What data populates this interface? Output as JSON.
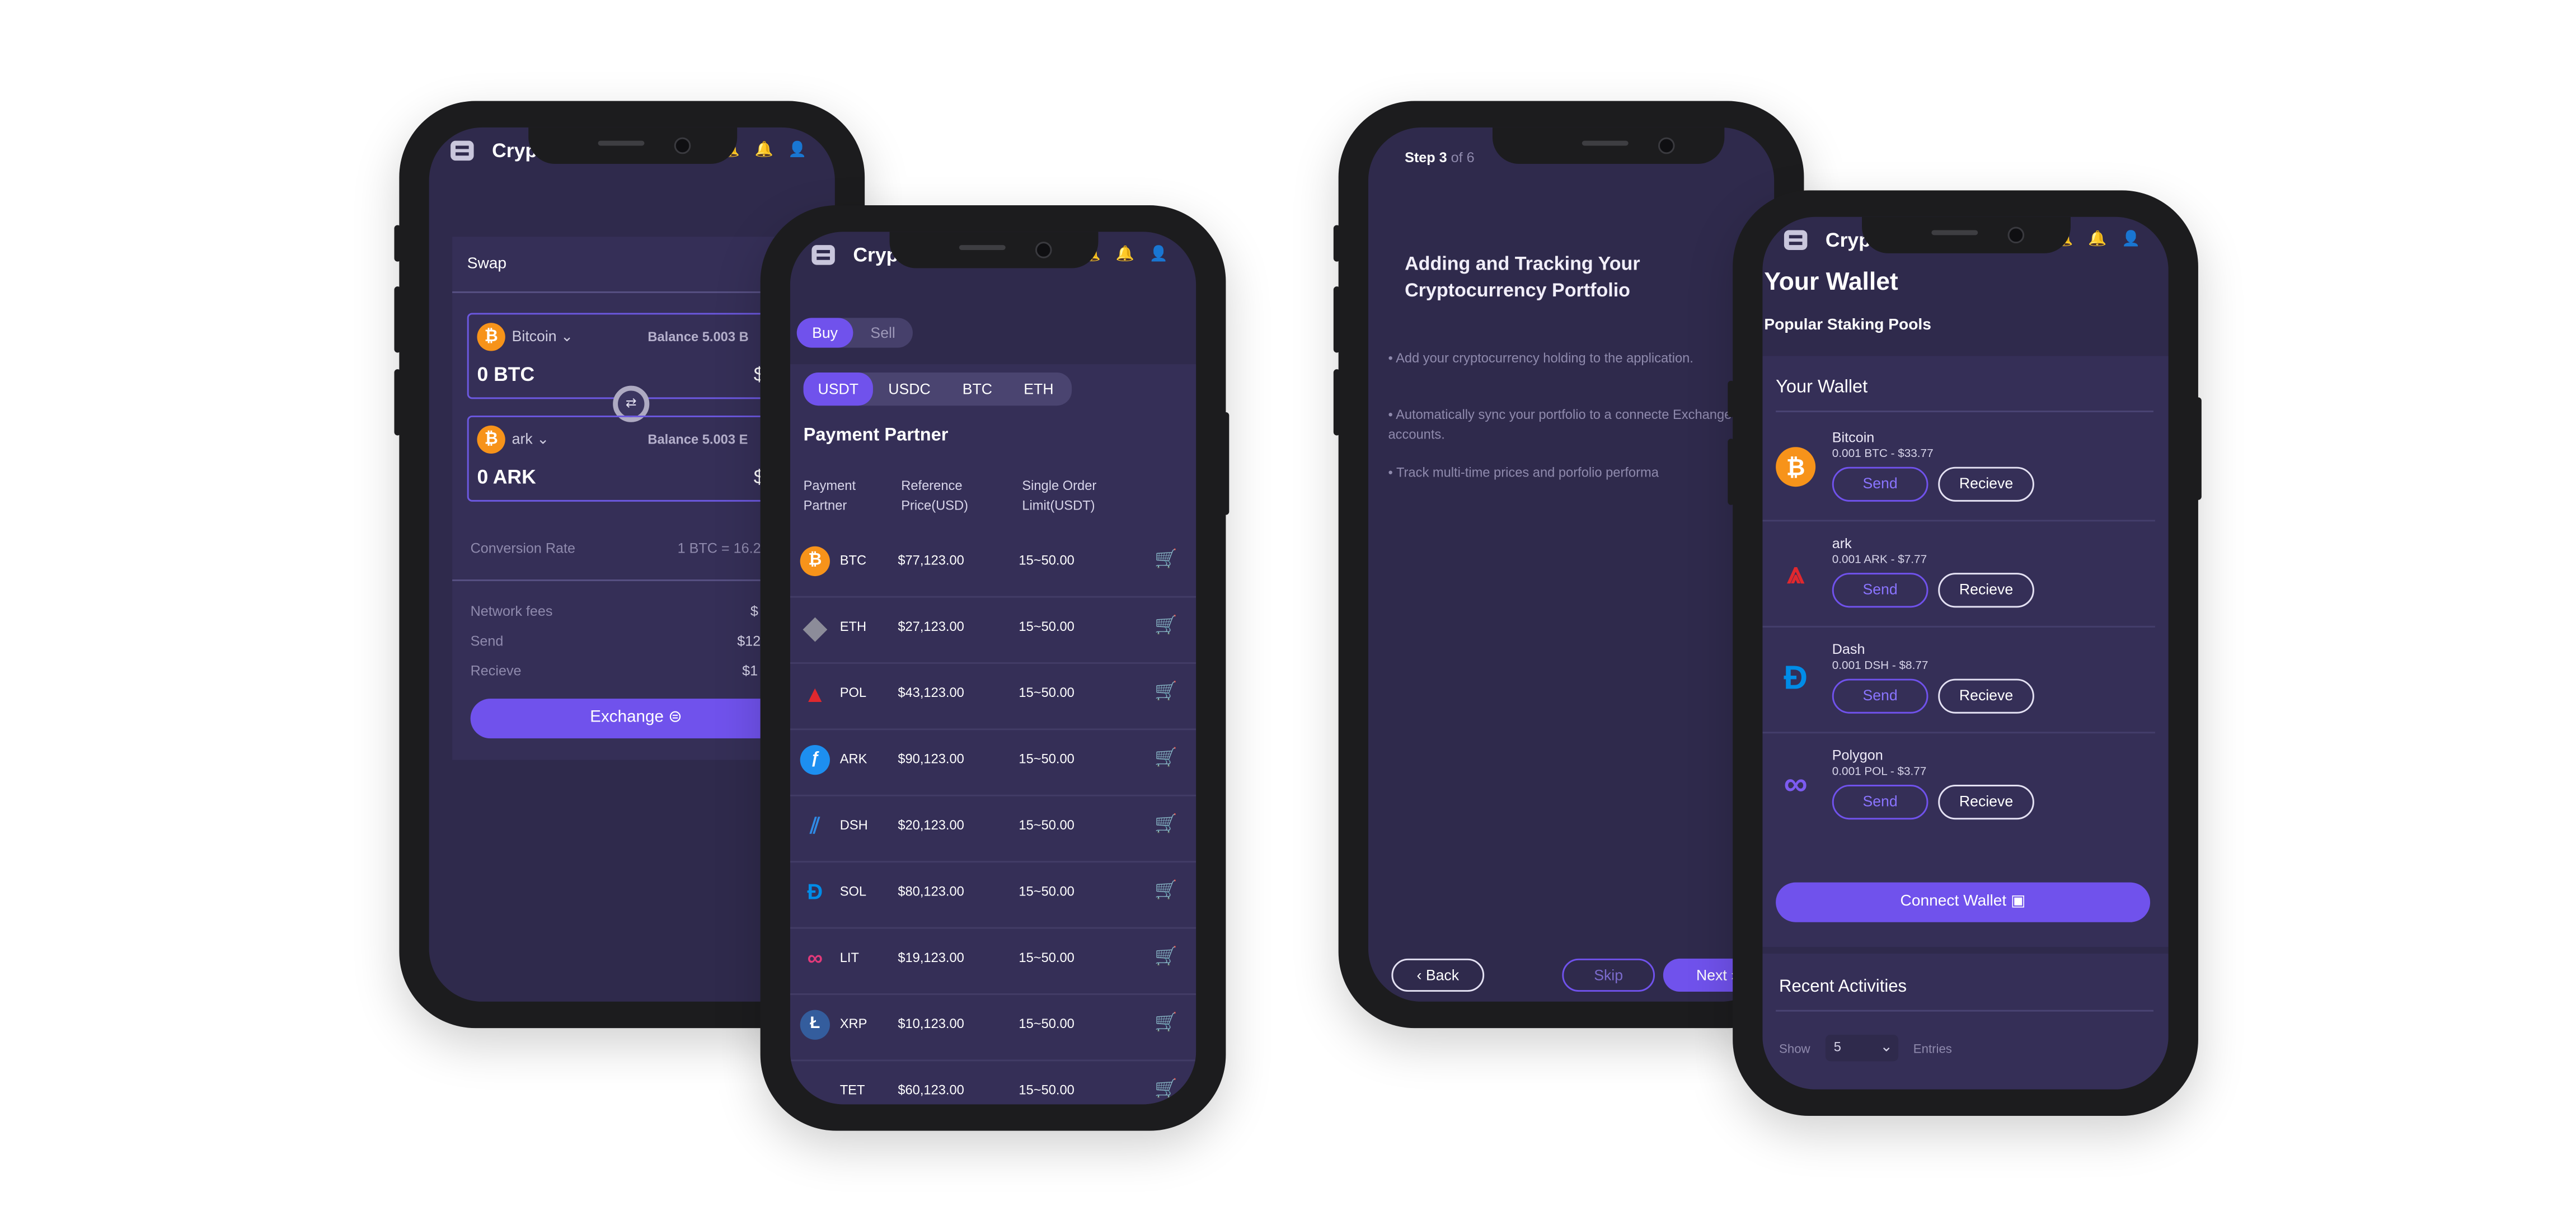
{
  "app_title": "Cryp",
  "header_icons": [
    "bell-icon",
    "bell-icon",
    "user-icon"
  ],
  "colors": {
    "background": "#ffffff",
    "screen": "#2f2a4c",
    "panel": "#352f57",
    "accent": "#7052ec",
    "bitcoin": "#f7931a",
    "ark": "#e0282e",
    "dash": "#008ce7"
  },
  "swap": {
    "title": "Swap",
    "from": {
      "coin": "Bitcoin",
      "balance": "Balance 5.003 B",
      "amount": "0 BTC",
      "icon": "bitcoin-icon"
    },
    "to": {
      "coin": "ark",
      "balance": "Balance 5.003 E",
      "amount": "0 ARK",
      "icon": "bitcoin-icon"
    },
    "conversion_label": "Conversion Rate",
    "conversion_value": "1 BTC = 16.2",
    "network_fees_label": "Network fees",
    "network_fees_value": "$",
    "send_label": "Send",
    "send_value": "$12",
    "recieve_label": "Recieve",
    "recieve_value": "$1",
    "exchange_label": "Exchange"
  },
  "market": {
    "buy_label": "Buy",
    "sell_label": "Sell",
    "tabs": [
      "USDT",
      "USDC",
      "BTC",
      "ETH"
    ],
    "section_title": "Payment Partner",
    "headers": [
      "Payment Partner",
      "Reference Price(USD)",
      "Single Order Limit(USDT)"
    ],
    "rows": [
      {
        "symbol": "BTC",
        "price": "$77,123.00",
        "limit": "15~50.00",
        "icon": "bitcoin-icon"
      },
      {
        "symbol": "ETH",
        "price": "$27,123.00",
        "limit": "15~50.00",
        "icon": "ethereum-icon"
      },
      {
        "symbol": "POL",
        "price": "$43,123.00",
        "limit": "15~50.00",
        "icon": "ark-icon"
      },
      {
        "symbol": "ARK",
        "price": "$90,123.00",
        "limit": "15~50.00",
        "icon": "filecoin-icon"
      },
      {
        "symbol": "DSH",
        "price": "$20,123.00",
        "limit": "15~50.00",
        "icon": "stripes-icon"
      },
      {
        "symbol": "SOL",
        "price": "$80,123.00",
        "limit": "15~50.00",
        "icon": "dash-icon"
      },
      {
        "symbol": "LIT",
        "price": "$19,123.00",
        "limit": "15~50.00",
        "icon": "polygon-icon"
      },
      {
        "symbol": "XRP",
        "price": "$10,123.00",
        "limit": "15~50.00",
        "icon": "litecoin-icon"
      },
      {
        "symbol": "TET",
        "price": "$60,123.00",
        "limit": "15~50.00",
        "icon": ""
      }
    ]
  },
  "onboarding": {
    "step_label": "Step 3",
    "step_of": "of 6",
    "title": "Adding and Tracking Your Cryptocurrency Portfolio",
    "bullets": [
      "Add your cryptocurrency holding to the application.",
      "Automatically sync your portfolio to a connecte Exchange accounts.",
      "Track multi-time prices and porfolio performa"
    ],
    "back_label": "Back",
    "skip_label": "Skip",
    "next_label": "Next"
  },
  "wallet": {
    "title": "Your Wallet",
    "subtitle": "Popular Staking Pools",
    "section_title": "Your Wallet",
    "send_label": "Send",
    "recieve_label": "Recieve",
    "items": [
      {
        "name": "Bitcoin",
        "value": "0.001 BTC - $33.77",
        "icon": "bitcoin-icon"
      },
      {
        "name": "ark",
        "value": "0.001 ARK - $7.77",
        "icon": "ark-icon"
      },
      {
        "name": "Dash",
        "value": "0.001 DSH - $8.77",
        "icon": "dash-icon"
      },
      {
        "name": "Polygon",
        "value": "0.001 POL - $3.77",
        "icon": "polygon-icon"
      }
    ],
    "connect_label": "Connect Wallet",
    "recent_title": "Recent Activities",
    "show_label": "Show",
    "show_value": "5",
    "entries_label": "Entries"
  }
}
